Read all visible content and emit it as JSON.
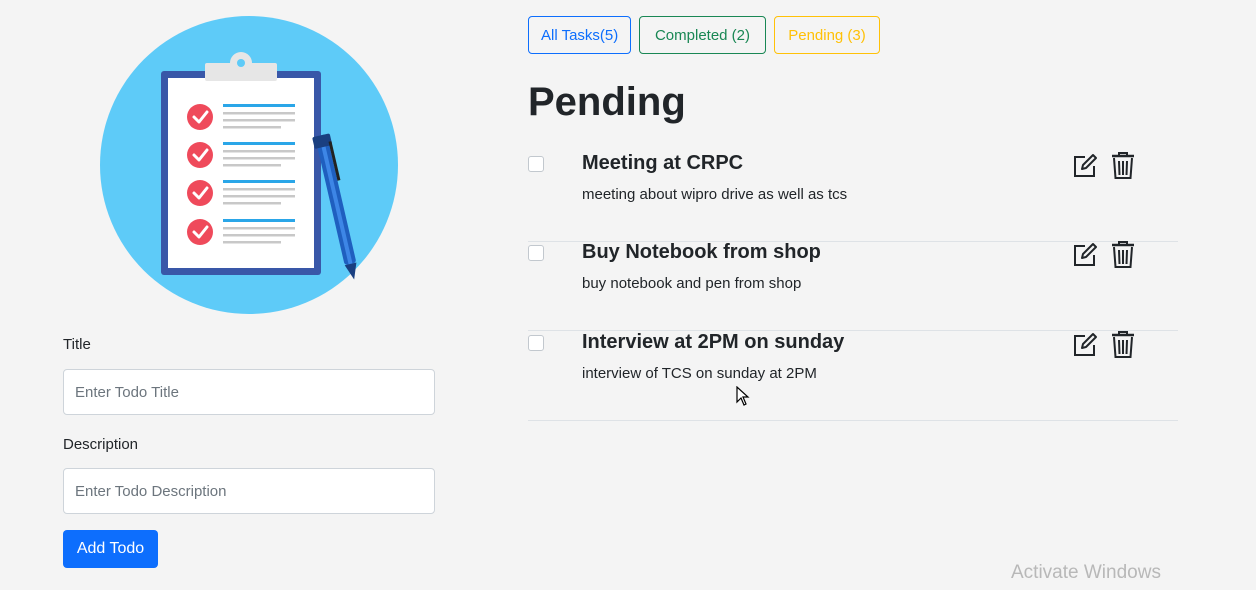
{
  "form": {
    "title_label": "Title",
    "title_placeholder": "Enter Todo Title",
    "description_label": "Description",
    "description_placeholder": "Enter Todo Description",
    "add_button_label": "Add Todo"
  },
  "filters": {
    "all_label": "All Tasks(5)",
    "completed_label": "Completed (2)",
    "pending_label": "Pending (3)"
  },
  "section_title": "Pending",
  "todos": [
    {
      "title": "Meeting at CRPC",
      "description": "meeting about wipro drive as well as tcs",
      "checked": false
    },
    {
      "title": "Buy Notebook from shop",
      "description": "buy notebook and pen from shop",
      "checked": false
    },
    {
      "title": "Interview at 2PM on sunday",
      "description": "interview of TCS on sunday at 2PM",
      "checked": false
    }
  ],
  "icons": {
    "edit": "edit-icon",
    "delete": "trash-icon",
    "illustration": "clipboard-checklist-illustration"
  },
  "colors": {
    "primary": "#0d6efd",
    "success": "#198754",
    "warning": "#ffc107",
    "illustration_bg": "#5ecbf8"
  },
  "watermark": "Activate Windows"
}
